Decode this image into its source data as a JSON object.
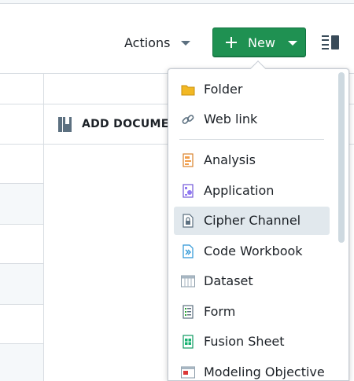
{
  "toolbar": {
    "actions_label": "Actions",
    "new_label": "New"
  },
  "table": {
    "column_header": "ADD DOCUMEN"
  },
  "menu": {
    "items": [
      {
        "label": "Folder",
        "icon": "folder-icon"
      },
      {
        "label": "Web link",
        "icon": "link-icon"
      },
      {
        "label": "Analysis",
        "icon": "analysis-icon"
      },
      {
        "label": "Application",
        "icon": "application-icon"
      },
      {
        "label": "Cipher Channel",
        "icon": "cipher-channel-icon"
      },
      {
        "label": "Code Workbook",
        "icon": "code-workbook-icon"
      },
      {
        "label": "Dataset",
        "icon": "dataset-icon"
      },
      {
        "label": "Form",
        "icon": "form-icon"
      },
      {
        "label": "Fusion Sheet",
        "icon": "fusion-sheet-icon"
      },
      {
        "label": "Modeling Objective",
        "icon": "modeling-objective-icon"
      }
    ],
    "active_item": "Cipher Channel"
  },
  "colors": {
    "primary_green": "#1f9152",
    "active_row": "#e1e8ed",
    "folder_yellow": "#f2b824"
  }
}
